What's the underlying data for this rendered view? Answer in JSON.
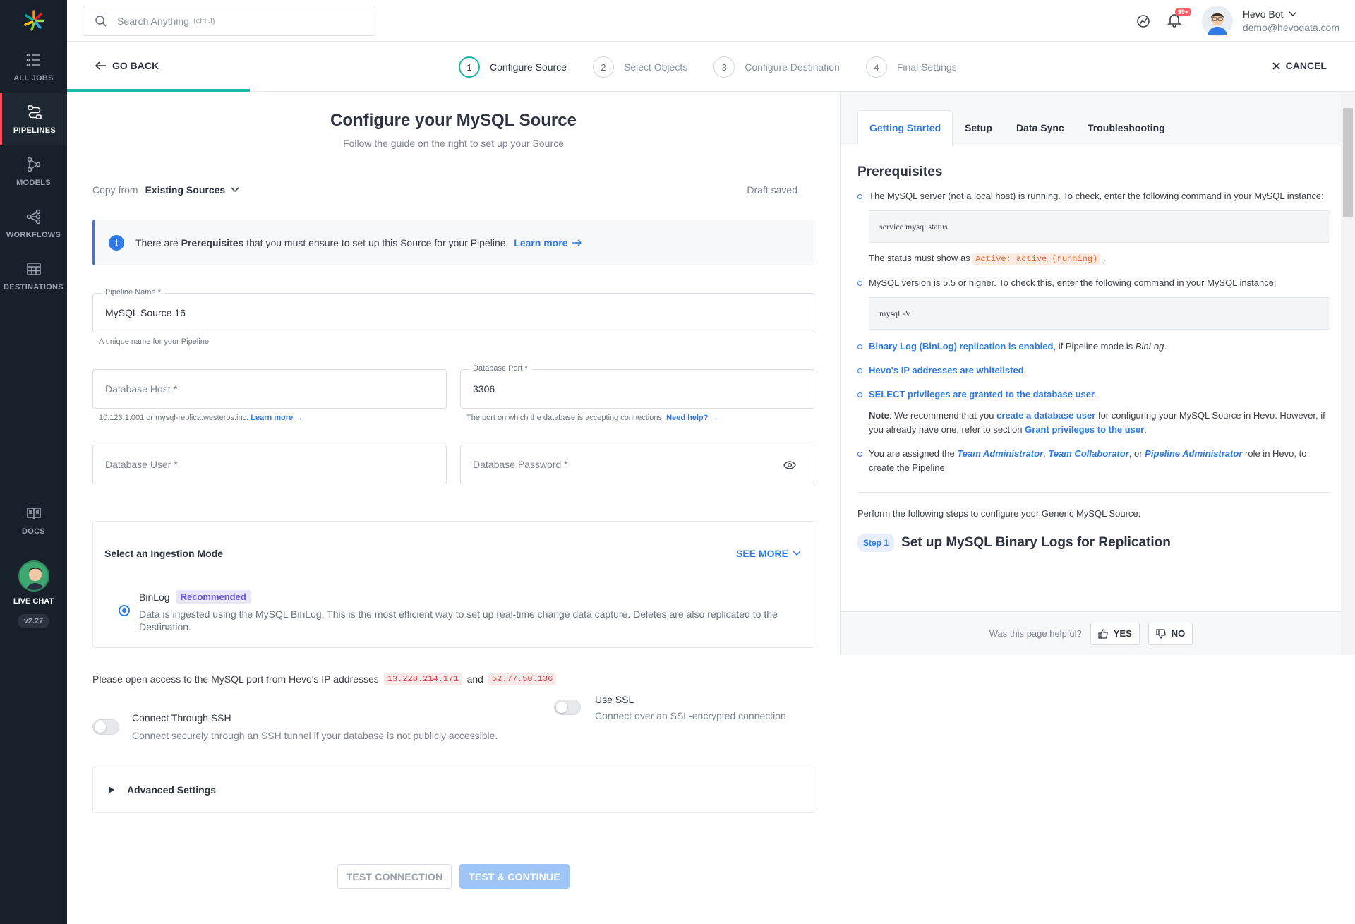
{
  "sidebar": {
    "items": [
      {
        "label": "ALL JOBS",
        "icon": "list-icon",
        "active": false
      },
      {
        "label": "PIPELINES",
        "icon": "pipelines-icon",
        "active": true
      },
      {
        "label": "MODELS",
        "icon": "models-icon",
        "active": false
      },
      {
        "label": "WORKFLOWS",
        "icon": "workflows-icon",
        "active": false
      },
      {
        "label": "DESTINATIONS",
        "icon": "destinations-icon",
        "active": false
      }
    ],
    "docs_label": "DOCS",
    "livechat_label": "LIVE CHAT",
    "version": "v2.27"
  },
  "topbar": {
    "search_placeholder": "Search Anything",
    "search_shortcut": "(ctrl J)",
    "notification_count": "99+",
    "user_name": "Hevo Bot",
    "user_email": "demo@hevodata.com"
  },
  "wizard": {
    "go_back": "GO BACK",
    "cancel": "CANCEL",
    "progress_fraction": 0.25,
    "steps": [
      {
        "num": "1",
        "label": "Configure Source"
      },
      {
        "num": "2",
        "label": "Select Objects"
      },
      {
        "num": "3",
        "label": "Configure Destination"
      },
      {
        "num": "4",
        "label": "Final Settings"
      }
    ]
  },
  "form": {
    "title": "Configure your MySQL Source",
    "subtitle": "Follow the guide on the right to set up your Source",
    "copy_from_label": "Copy from",
    "copy_from_value": "Existing Sources",
    "draft_status": "Draft saved",
    "prereq": {
      "text_before": "There are",
      "text_bold": "Prerequisites",
      "text_after": "that you must ensure to set up this Source for your Pipeline.",
      "link": "Learn more"
    },
    "pipeline_name": {
      "label": "Pipeline Name *",
      "value": "MySQL Source 16",
      "helper": "A unique name for your Pipeline"
    },
    "db_host": {
      "placeholder": "Database Host *",
      "helper": "10.123.1.001 or mysql-replica.westeros.inc.",
      "helper_link": "Learn more"
    },
    "db_port": {
      "label": "Database Port *",
      "value": "3306",
      "helper": "The port on which the database is accepting connections.",
      "helper_link": "Need help?"
    },
    "db_user": {
      "placeholder": "Database User *"
    },
    "db_password": {
      "placeholder": "Database Password *"
    },
    "ingestion": {
      "title": "Select an Ingestion Mode",
      "see_more": "SEE MORE",
      "mode": "BinLog",
      "badge": "Recommended",
      "description": "Data is ingested using the MySQL BinLog. This is the most efficient way to set up real-time change data capture. Deletes are also replicated to the Destination."
    },
    "ip_note": {
      "text": "Please open access to the MySQL port from Hevo's IP addresses",
      "ip1": "13.228.214.171",
      "and": "and",
      "ip2": "52.77.50.136"
    },
    "ssh": {
      "title": "Connect Through SSH",
      "desc": "Connect securely through an SSH tunnel if your database is not publicly accessible."
    },
    "ssl": {
      "title": "Use SSL",
      "desc": "Connect over an SSL-encrypted connection"
    },
    "advanced": "Advanced Settings",
    "test_connection": "TEST CONNECTION",
    "test_continue": "TEST & CONTINUE"
  },
  "docs": {
    "tabs": [
      "Getting Started",
      "Setup",
      "Data Sync",
      "Troubleshooting"
    ],
    "heading": "Prerequisites",
    "p1": "The MySQL server (not a local host) is running. To check, enter the following command in your MySQL instance:",
    "code1": "service mysql status",
    "status_text": "The status must show as",
    "status_code": "Active: active (running)",
    "p2": "MySQL version is 5.5 or higher. To check this, enter the following command in your MySQL instance:",
    "code2": "mysql -V",
    "p3_link": "Binary Log (BinLog) replication is enabled",
    "p3_rest": ", if Pipeline mode is",
    "p3_italic": "BinLog",
    "p4_link": "Hevo's IP addresses are whitelisted",
    "p5_link": "SELECT privileges are granted to the database user",
    "note_label": "Note",
    "note_text1": ": We recommend that you",
    "note_link1": "create a database user",
    "note_text2": "for configuring your MySQL Source in Hevo. However, if you already have one, refer to section",
    "note_link2": "Grant privileges to the user",
    "p6_text1": "You are assigned the",
    "p6_link1": "Team Administrator",
    "p6_link2": "Team Collaborator",
    "p6_text2": ", or",
    "p6_link3": "Pipeline Administrator",
    "p6_text3": "role in Hevo, to create the Pipeline.",
    "perform": "Perform the following steps to configure your Generic MySQL Source:",
    "step_pill": "Step 1",
    "step_title": "Set up MySQL Binary Logs for Replication",
    "feedback_q": "Was this page helpful?",
    "yes": "YES",
    "no": "NO"
  },
  "colors": {
    "accent": "#2f7ae5",
    "teal": "#1bb7aa",
    "sidebar": "#17202b",
    "active_marker": "#ff4d5e"
  }
}
